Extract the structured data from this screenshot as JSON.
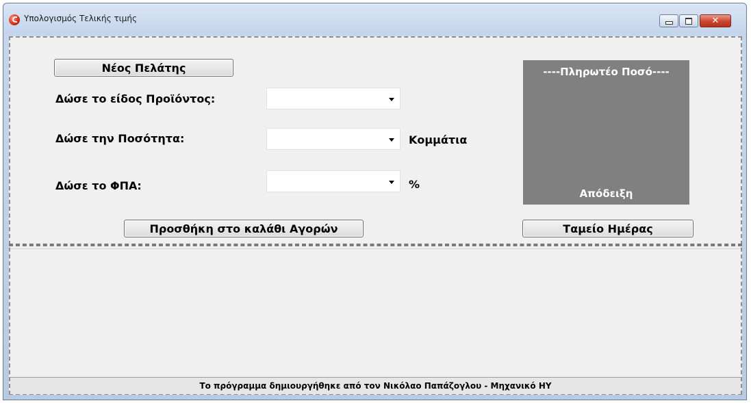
{
  "window": {
    "title": "Υπολογισμός Τελικής τιμής",
    "minimize_label": "▭",
    "maximize_label": "◻",
    "close_label": "✕"
  },
  "form": {
    "new_customer_button": "Νέος Πελάτης",
    "product_label": "Δώσε το είδος Προϊόντος:",
    "product_value": "",
    "quantity_label": "Δώσε την Ποσότητα:",
    "quantity_value": "",
    "quantity_unit": "Κομμάτια",
    "vat_label": "Δώσε το ΦΠΑ:",
    "vat_value": "",
    "vat_unit": "%",
    "add_to_cart_button": "Προσθήκη στο καλάθι Αγορών"
  },
  "payment": {
    "title": "----Πληρωτέο Ποσό----",
    "receipt_label": "Απόδειξη",
    "daily_register_button": "Ταμείο Ημέρας"
  },
  "footer": {
    "text": "Το πρόγραμμα δημιουργήθηκε από τον Νικόλαο Παπάζογλου - Μηχανικό ΗΥ"
  },
  "colors": {
    "panel_background": "#808080",
    "client_background": "#f0f0f0"
  }
}
